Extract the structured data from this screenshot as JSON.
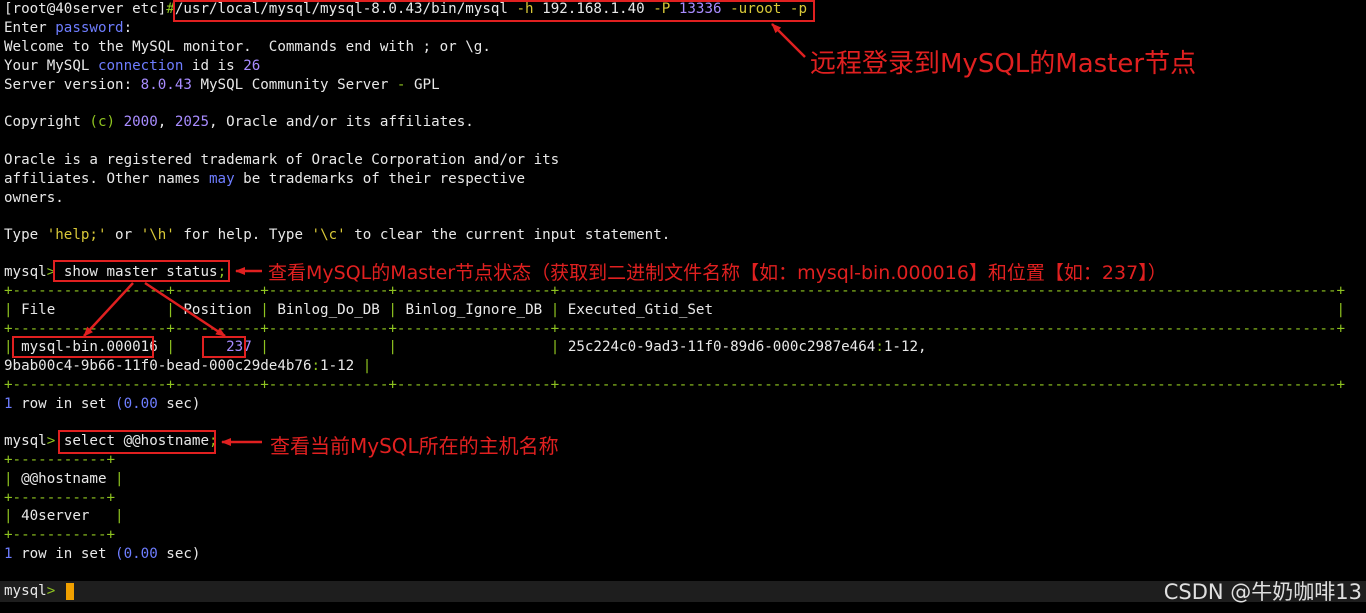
{
  "terminal": {
    "prompt_root": "[root@40server etc]",
    "hash": "#",
    "login_cmd": {
      "bin": "/usr/local/mysql/mysql-8.0.43/bin/mysql",
      "h_flag": "-h",
      "host": "192.168.1.40",
      "p_flag": "-P",
      "port": "13336",
      "user_flag": "-uroot",
      "pw_flag": "-p"
    },
    "enter_password": {
      "pre": "Enter ",
      "word": "password",
      "post": ":"
    },
    "welcome": "Welcome to the MySQL monitor.  Commands end with ; or \\g.",
    "conn": {
      "pre": "Your MySQL ",
      "word": "connection",
      "mid": " id is ",
      "id": "26"
    },
    "version": {
      "pre": "Server version: ",
      "num": "8.0.43",
      "mid": " MySQL Community Server ",
      "dash": "-",
      "post": " GPL"
    },
    "copyright": {
      "pre": "Copyright ",
      "c": "(c)",
      "y1": "2000",
      "comma": ", ",
      "y2": "2025",
      "post": ", Oracle and/or its affiliates."
    },
    "oracle1": "Oracle is a registered trademark of Oracle Corporation and/or its",
    "oracle2": {
      "pre": "affiliates. Other names ",
      "may": "may",
      "post": " be trademarks of their respective"
    },
    "oracle3": "owners.",
    "help": {
      "pre": "Type ",
      "q1": "'help;'",
      "mid1": " or ",
      "q2": "'\\h'",
      "mid2": " for help. Type ",
      "q3": "'\\c'",
      "post": " to clear the current input statement."
    },
    "mysql_prompt": "mysql",
    "gt": ">",
    "cmd1": "show master status",
    "semi": ";",
    "sep1": "+------------------+----------+--------------+------------------+-------------------------------------------------------------------------------------------+",
    "head1": {
      "c1": " File             ",
      "c2": " Position ",
      "c3": " Binlog_Do_DB ",
      "c4": " Binlog_Ignore_DB ",
      "c5": " Executed_Gtid_Set                                                                         "
    },
    "bar": "|",
    "file": "mysql-bin.000016",
    "position": "237",
    "gtid1a": "25c224c0-9ad3-11f0-89d6-000c2987e464",
    "gtid1b": "1-12,",
    "gtid2a": "9bab00c4-9b66-11f0-bead-000c29de4b76",
    "gtid2b": "1-12",
    "colon": ":",
    "rowset": {
      "one": "1",
      "mid": " row in set ",
      "time": "(0.00",
      "post": " sec)"
    },
    "cmd2": "select @@hostname",
    "sep2": "+-----------+",
    "head2": " @@hostname ",
    "hostname": " 40server   "
  },
  "annotations": {
    "a1": "远程登录到MySQL的Master节点",
    "a2": "查看MySQL的Master节点状态（获取到二进制文件名称【如：mysql-bin.000016】和位置【如：237】）",
    "a3": "查看当前MySQL所在的主机名称"
  },
  "watermark": "CSDN @牛奶咖啡13",
  "colors": {
    "annotation": "#e02020",
    "green": "#8ec320",
    "blue": "#6e7dff",
    "purple": "#a88cff",
    "cursor": "#f0a000"
  }
}
